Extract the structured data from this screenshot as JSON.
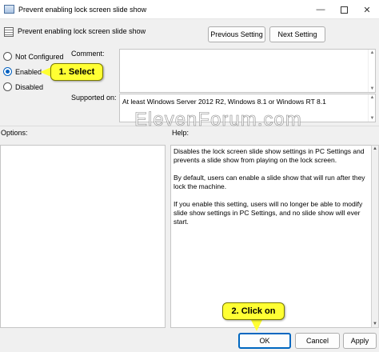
{
  "window": {
    "title": "Prevent enabling lock screen slide show",
    "minimize_glyph": "—",
    "close_glyph": "✕"
  },
  "header": {
    "policy_name": "Prevent enabling lock screen slide show",
    "previous_setting": "Previous Setting",
    "next_setting": "Next Setting"
  },
  "state": {
    "not_configured": "Not Configured",
    "enabled": "Enabled",
    "disabled": "Disabled",
    "selected": "enabled"
  },
  "comment": {
    "label": "Comment:",
    "value": ""
  },
  "supported": {
    "label": "Supported on:",
    "value": "At least Windows Server 2012 R2, Windows 8.1 or Windows RT 8.1"
  },
  "options": {
    "label": "Options:"
  },
  "help": {
    "label": "Help:",
    "paragraphs": [
      "Disables the lock screen slide show settings in PC Settings and prevents a slide show from playing on the lock screen.",
      "By default, users can enable a slide show that will run after they lock the machine.",
      "If you enable this setting, users will no longer be able to modify slide show settings in PC Settings, and no slide show will ever start."
    ]
  },
  "watermark": "ElevenForum.com",
  "footer": {
    "ok": "OK",
    "cancel": "Cancel",
    "apply": "Apply"
  },
  "callouts": {
    "select": "1. Select",
    "click": "2. Click on"
  },
  "colors": {
    "accent": "#0067c0",
    "callout": "#ffff33"
  }
}
